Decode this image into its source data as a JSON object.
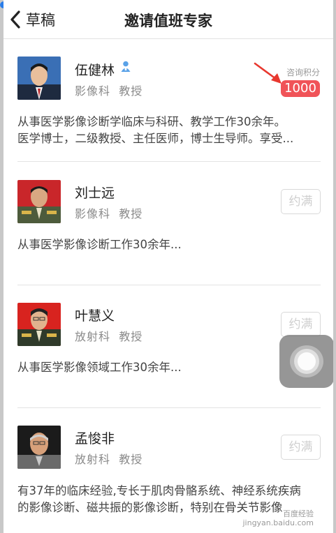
{
  "nav": {
    "back_label": "草稿",
    "title": "邀请值班专家"
  },
  "experts": [
    {
      "name": "伍健林",
      "department": "影像科",
      "rank": "教授",
      "score_label": "咨询积分",
      "score": "1000",
      "description": "从事医学影像诊断学临床与科研、教学工作30余年。\n医学博士，二级教授、主任医师，博士生导师。享受..."
    },
    {
      "name": "刘士远",
      "department": "影像科",
      "rank": "教授",
      "button_label": "约满",
      "description": "从事医学影像诊断工作30余年..."
    },
    {
      "name": "叶慧义",
      "department": "放射科",
      "rank": "教授",
      "button_label": "约满",
      "description": "从事医学影像领域工作30余年..."
    },
    {
      "name": "孟悛非",
      "department": "放射科",
      "rank": "教授",
      "button_label": "约满",
      "description": "有37年的临床经验,专长于肌肉骨骼系统、神经系统疾病\n的影像诊断、磁共振的影像诊断，特别在骨关节影像"
    }
  ],
  "watermark": {
    "line1": "百度经验",
    "line2": "jingyan.baidu.com"
  },
  "colors": {
    "accent_red": "#f05358",
    "annotation_arrow": "#e8382f",
    "disabled_text": "#cfcfcf"
  }
}
